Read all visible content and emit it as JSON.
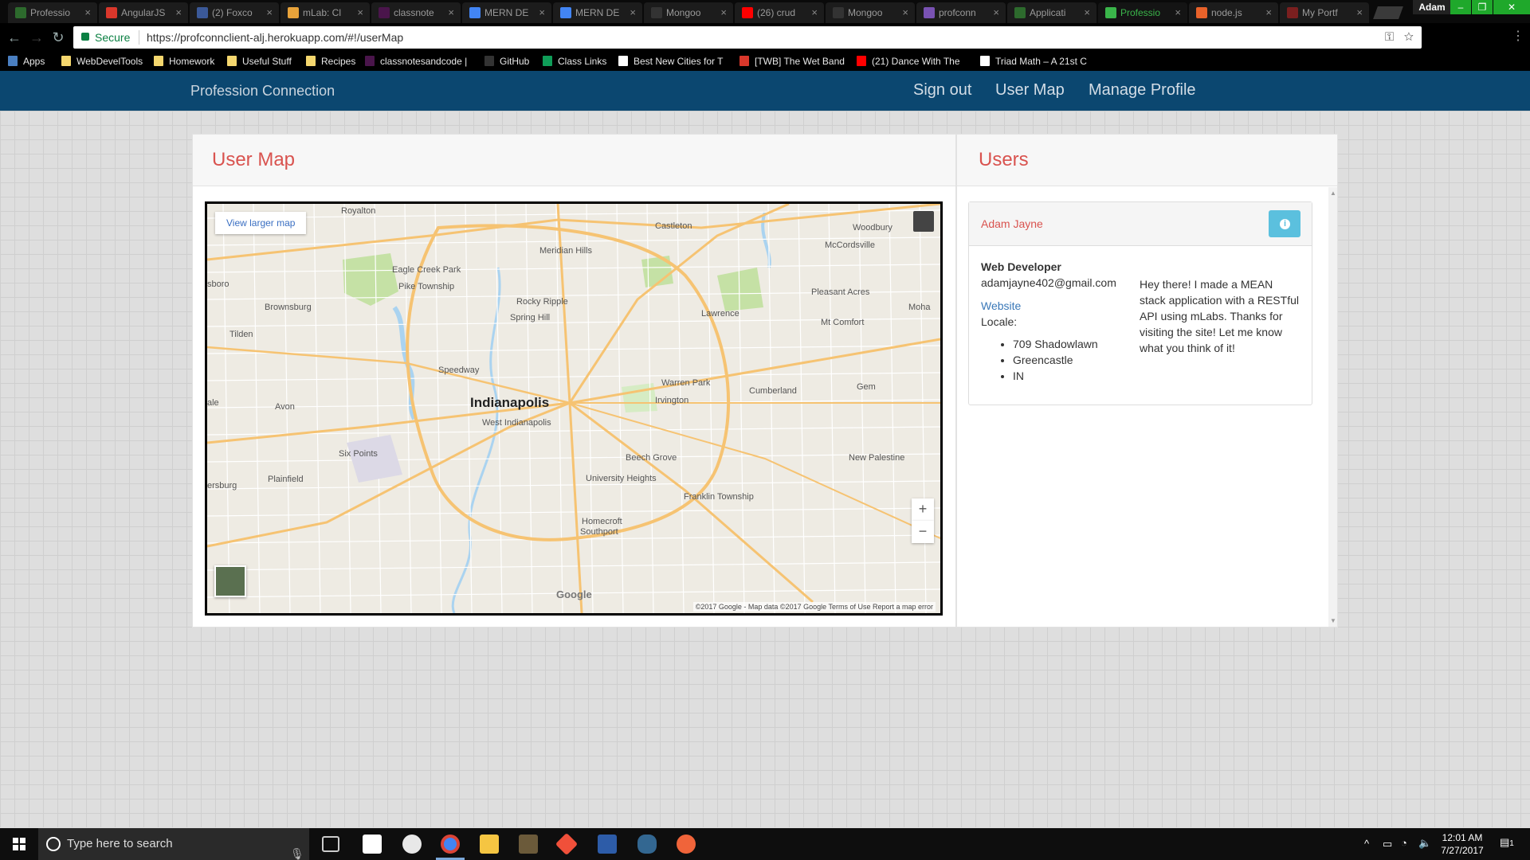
{
  "browser": {
    "tabs": [
      {
        "label": "Professio",
        "color": "#2d6a2d"
      },
      {
        "label": "AngularJS",
        "color": "#d9372b"
      },
      {
        "label": "(2) Foxco",
        "color": "#3b5998"
      },
      {
        "label": "mLab: Cl",
        "color": "#e8a33a"
      },
      {
        "label": "classnote",
        "color": "#4a154b"
      },
      {
        "label": "MERN DE",
        "color": "#4285f4"
      },
      {
        "label": "MERN DE",
        "color": "#4285f4"
      },
      {
        "label": "Mongoo",
        "color": "#333333"
      },
      {
        "label": "(26) crud",
        "color": "#ff0000"
      },
      {
        "label": "Mongoo",
        "color": "#333333"
      },
      {
        "label": "profconn",
        "color": "#7952b3"
      },
      {
        "label": "Applicati",
        "color": "#2d6a2d"
      },
      {
        "label": "Professio",
        "color": "#3ab54a",
        "active": true
      },
      {
        "label": "node.js",
        "color": "#e8622a"
      },
      {
        "label": "My Portf",
        "color": "#7a1f1f"
      }
    ],
    "profile_name": "Adam",
    "secure_label": "Secure",
    "url": "https://profconnclient-alj.herokuapp.com/#!/userMap"
  },
  "bookmarks": [
    {
      "label": "Apps",
      "color": "#4a7fc1"
    },
    {
      "label": "WebDevelTools",
      "color": "#f5d76e"
    },
    {
      "label": "Homework",
      "color": "#f5d76e"
    },
    {
      "label": "Useful Stuff",
      "color": "#f5d76e"
    },
    {
      "label": "Recipes",
      "color": "#f5d76e"
    },
    {
      "label": "classnotesandcode |",
      "color": "#4a154b"
    },
    {
      "label": "GitHub",
      "color": "#333333"
    },
    {
      "label": "Class Links",
      "color": "#0f9d58"
    },
    {
      "label": "Best New Cities for T",
      "color": "#ffffff"
    },
    {
      "label": "[TWB] The Wet Band",
      "color": "#d9372b"
    },
    {
      "label": "(21) Dance With The",
      "color": "#ff0000"
    },
    {
      "label": "Triad Math – A 21st C",
      "color": "#ffffff"
    }
  ],
  "app": {
    "brand": "Profession Connection",
    "nav": [
      "Sign out",
      "User Map",
      "Manage Profile"
    ]
  },
  "map_panel": {
    "title": "User Map",
    "view_larger": "View larger map",
    "zoom_in": "+",
    "zoom_out": "−",
    "attribution": "©2017 Google - Map data ©2017 Google    Terms of Use    Report a map error",
    "logo": "Google",
    "labels": {
      "city": "Indianapolis",
      "places": [
        "Royalton",
        "Woodbury",
        "McCordsville",
        "Meridian Hills",
        "Eagle Creek Park",
        "Pike Township",
        "Brownsburg",
        "Rocky Ripple",
        "Spring Hill",
        "Lawrence",
        "Pleasant Acres",
        "Mt Comfort",
        "Tilden",
        "Speedway",
        "Warren Park",
        "Cumberland",
        "Gem",
        "Avon",
        "Irvington",
        "West Indianapolis",
        "Six Points",
        "Plainfield",
        "Beech Grove",
        "University Heights",
        "New Palestine",
        "Franklin Township",
        "Southport",
        "Castleton",
        "Moha",
        "sboro",
        "ale",
        "ersburg",
        "Homecroft"
      ]
    }
  },
  "users_panel": {
    "title": "Users",
    "user": {
      "name": "Adam Jayne",
      "job": "Web Developer",
      "email": "adamjayne402@gmail.com",
      "website": "Website",
      "locale_label": "Locale:",
      "locale": [
        "709 Shadowlawn",
        "Greencastle",
        "IN"
      ],
      "about": "Hey there! I made a MEAN stack application with a RESTful API using mLabs. Thanks for visiting the site! Let me know what you think of it!"
    }
  },
  "taskbar": {
    "search_placeholder": "Type here to search",
    "time": "12:01 AM",
    "date": "7/27/2017",
    "notification_count": "1"
  }
}
